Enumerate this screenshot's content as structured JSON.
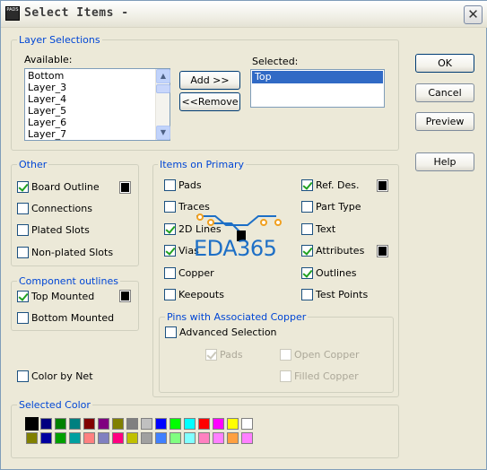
{
  "window": {
    "title": "Select Items -",
    "icon_text": "PADS",
    "close_glyph": "✕"
  },
  "layer_selections": {
    "group_label": "Layer Selections",
    "available_label": "Available:",
    "available_items": [
      "Bottom",
      "Layer_3",
      "Layer_4",
      "Layer_5",
      "Layer_6",
      "Layer_7"
    ],
    "selected_label": "Selected:",
    "selected_items": [
      "Top"
    ],
    "add_button": "Add >>",
    "remove_button": "<<Remove"
  },
  "buttons": {
    "ok": "OK",
    "cancel": "Cancel",
    "preview": "Preview",
    "help": "Help"
  },
  "other": {
    "group_label": "Other",
    "items": [
      {
        "label": "Board Outline",
        "checked": true,
        "swatch": "#000000"
      },
      {
        "label": "Connections",
        "checked": false
      },
      {
        "label": "Plated Slots",
        "checked": false
      },
      {
        "label": "Non-plated Slots",
        "checked": false
      }
    ]
  },
  "component_outlines": {
    "group_label": "Component outlines",
    "items": [
      {
        "label": "Top Mounted",
        "checked": true,
        "swatch": "#000000"
      },
      {
        "label": "Bottom Mounted",
        "checked": false
      }
    ]
  },
  "color_by_net": {
    "label": "Color by Net",
    "checked": false
  },
  "items_on_primary": {
    "group_label": "Items on Primary",
    "left": [
      {
        "label": "Pads",
        "checked": false
      },
      {
        "label": "Traces",
        "checked": false
      },
      {
        "label": "2D Lines",
        "checked": true
      },
      {
        "label": "Vias",
        "checked": true
      },
      {
        "label": "Copper",
        "checked": false
      },
      {
        "label": "Keepouts",
        "checked": false
      }
    ],
    "right": [
      {
        "label": "Ref. Des.",
        "checked": true,
        "swatch": "#000000"
      },
      {
        "label": "Part Type",
        "checked": false
      },
      {
        "label": "Text",
        "checked": false
      },
      {
        "label": "Attributes",
        "checked": true,
        "swatch": "#000000"
      },
      {
        "label": "Outlines",
        "checked": true
      },
      {
        "label": "Test Points",
        "checked": false
      }
    ]
  },
  "pins_copper": {
    "group_label": "Pins with Associated Copper",
    "advanced": {
      "label": "Advanced Selection",
      "checked": false
    },
    "pads": {
      "label": "Pads",
      "checked": true
    },
    "open_copper": {
      "label": "Open Copper",
      "checked": false
    },
    "filled_copper": {
      "label": "Filled Copper",
      "checked": false
    }
  },
  "selected_color": {
    "group_label": "Selected Color",
    "row1": [
      "#000000",
      "#000080",
      "#008000",
      "#008080",
      "#800000",
      "#800080",
      "#808000",
      "#808080",
      "#c0c0c0",
      "#0000ff",
      "#00ff00",
      "#00ffff",
      "#ff0000",
      "#ff00ff",
      "#ffff00",
      "#ffffff"
    ],
    "row2": [
      "#808000",
      "#0000a0",
      "#00a000",
      "#00a0a0",
      "#ff8080",
      "#8080c0",
      "#ff0080",
      "#c0c000",
      "#a0a0a0",
      "#4080ff",
      "#80ff80",
      "#80ffff",
      "#ff80c0",
      "#ff80ff",
      "#ffa040",
      "#ff80ff"
    ],
    "selected_index": 0
  },
  "watermark": {
    "text": "EDA365"
  }
}
